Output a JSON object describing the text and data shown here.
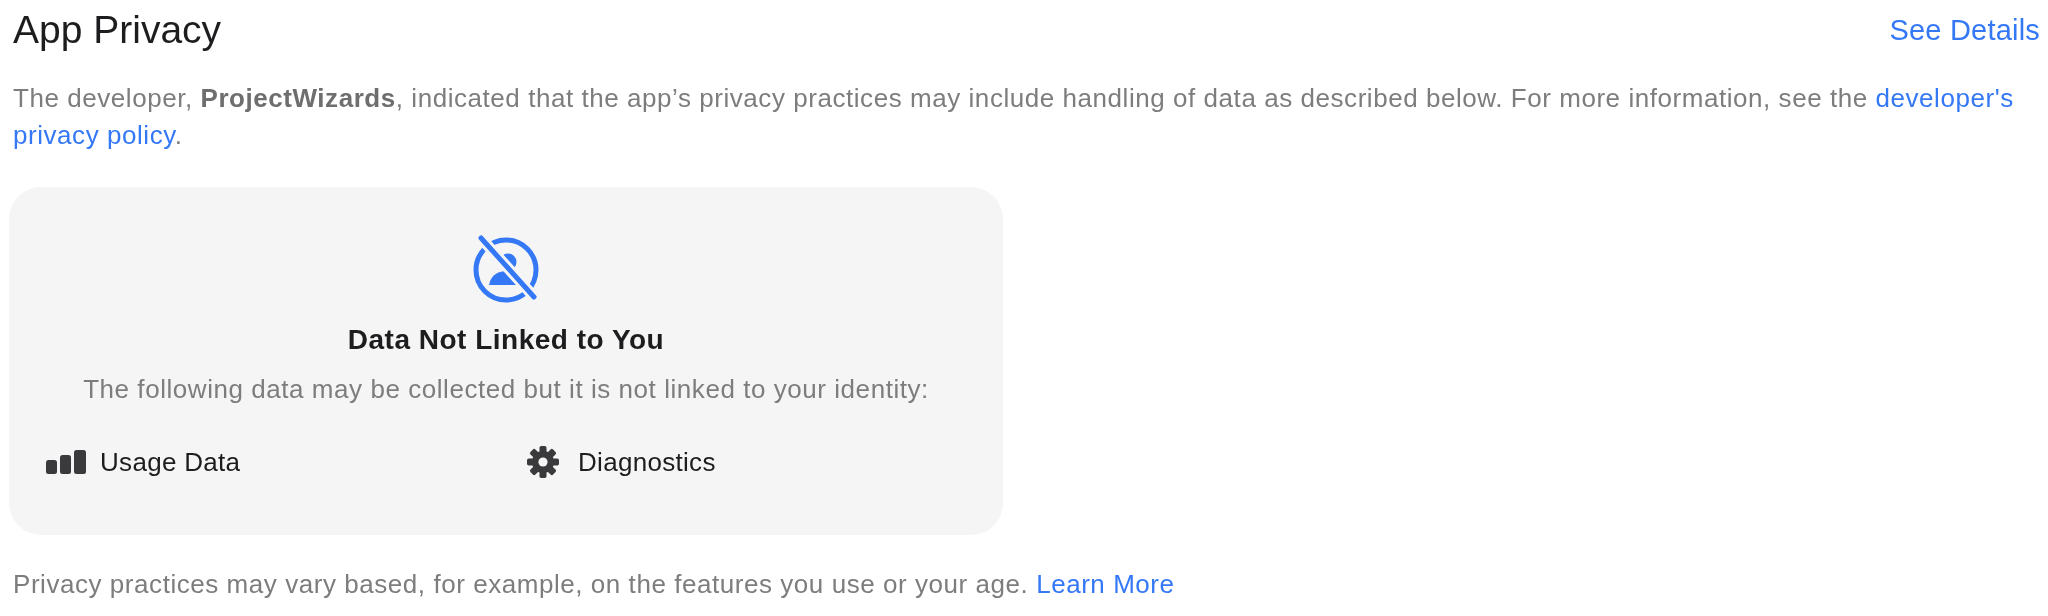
{
  "header": {
    "title": "App Privacy",
    "link": "See Details"
  },
  "description": {
    "text": "The developer, **ProjectWizards**, indicated that the app’s privacy practices may include handling of data as described below. For more information, see the",
    "link": [
      "developer's",
      "privacy policy"
    ],
    "end": "."
  },
  "card": {
    "title": "Data Not Linked to You",
    "subtitle": "The following data may be collected but it is not linked to your identity:",
    "items": [
      {
        "kind": "usage",
        "label": "Usage Data"
      },
      {
        "kind": "diagnostics",
        "label": "Diagnostics"
      }
    ]
  },
  "footer": {
    "text": "Privacy practices may vary based, for example, on the features you use or your age.",
    "link": "Learn More"
  }
}
